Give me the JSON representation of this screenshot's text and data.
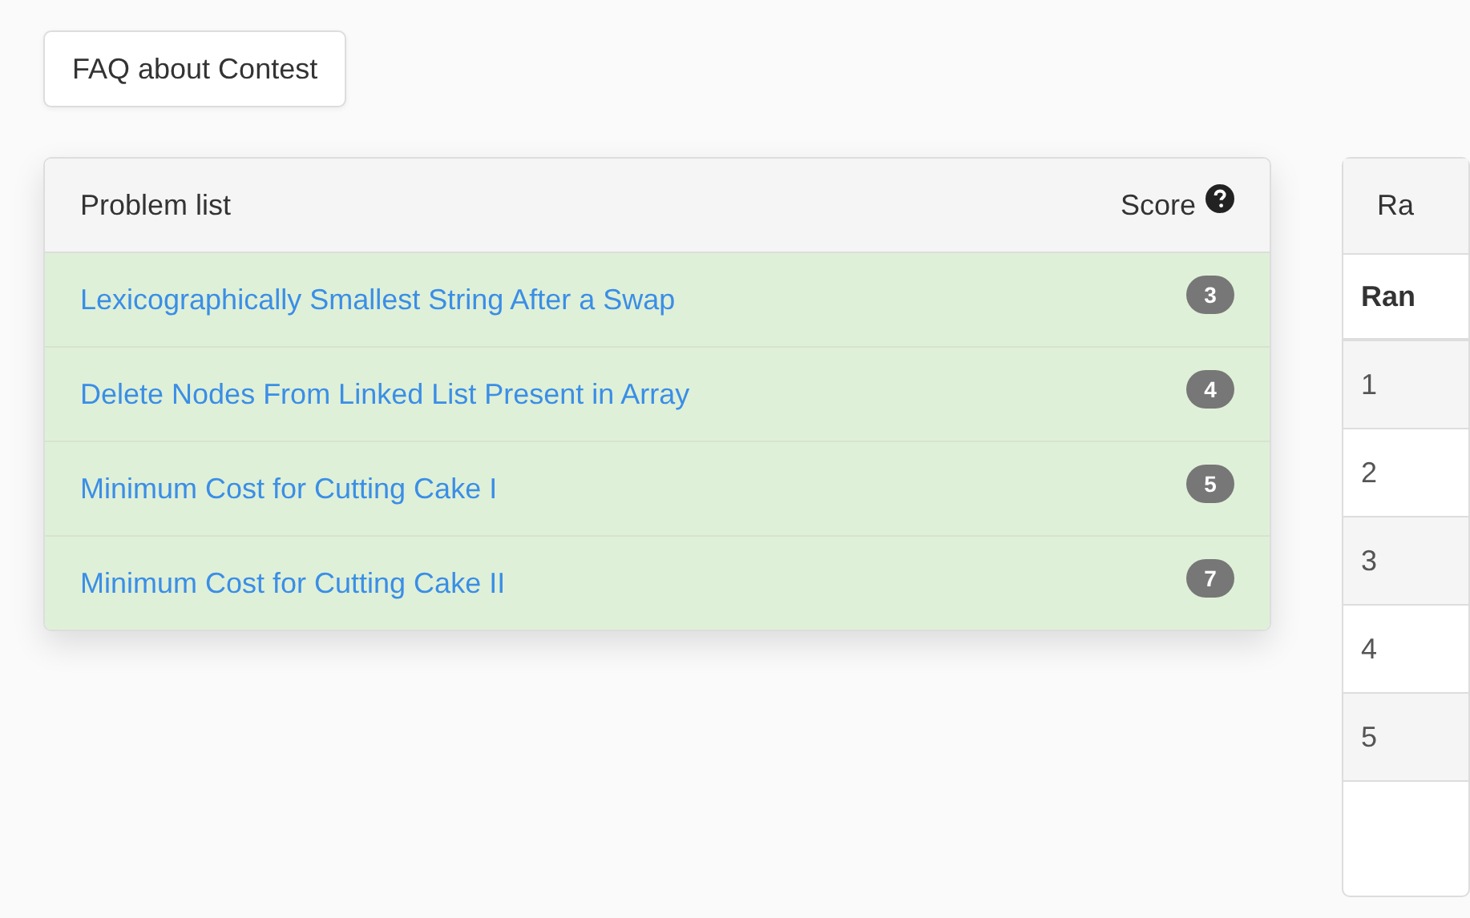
{
  "faq_button": {
    "label": "FAQ about Contest"
  },
  "problem_list": {
    "title": "Problem list",
    "score_label": "Score",
    "problems": [
      {
        "title": "Lexicographically Smallest String After a Swap",
        "score": "3",
        "solved": true
      },
      {
        "title": "Delete Nodes From Linked List Present in Array",
        "score": "4",
        "solved": true
      },
      {
        "title": "Minimum Cost for Cutting Cake I",
        "score": "5",
        "solved": true
      },
      {
        "title": "Minimum Cost for Cutting Cake II",
        "score": "7",
        "solved": true
      }
    ]
  },
  "ranking": {
    "title": "Ra",
    "columns": [
      "Ran"
    ],
    "rows": [
      "1",
      "2",
      "3",
      "4",
      "5"
    ]
  }
}
